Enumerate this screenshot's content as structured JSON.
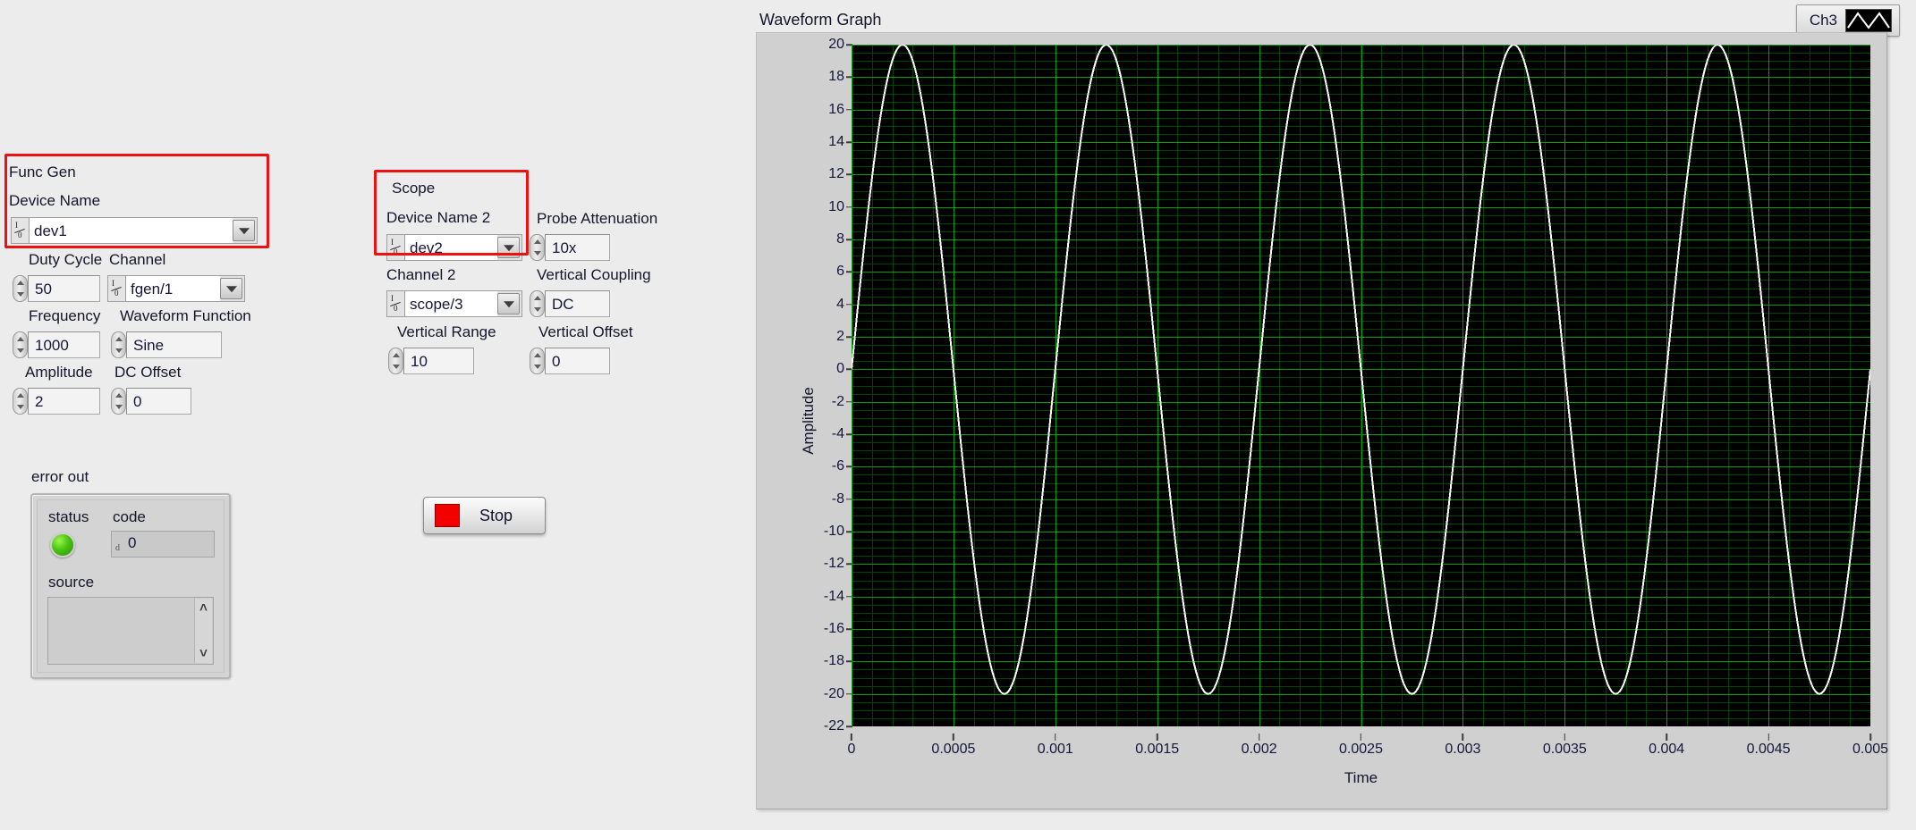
{
  "func_gen": {
    "group_label": "Func Gen",
    "device_name_label": "Device Name",
    "device_name_value": "dev1",
    "duty_cycle_label": "Duty Cycle",
    "duty_cycle_value": "50",
    "channel_label": "Channel",
    "channel_value": "fgen/1",
    "frequency_label": "Frequency",
    "frequency_value": "1000",
    "waveform_function_label": "Waveform Function",
    "waveform_function_value": "Sine",
    "amplitude_label": "Amplitude",
    "amplitude_value": "2",
    "dc_offset_label": "DC Offset",
    "dc_offset_value": "0"
  },
  "scope": {
    "group_label": "Scope",
    "device_name_label": "Device Name 2",
    "device_name_value": "dev2",
    "channel_label": "Channel 2",
    "channel_value": "scope/3",
    "vertical_range_label": "Vertical Range",
    "vertical_range_value": "10",
    "probe_attenuation_label": "Probe Attenuation",
    "probe_attenuation_value": "10x",
    "vertical_coupling_label": "Vertical Coupling",
    "vertical_coupling_value": "DC",
    "vertical_offset_label": "Vertical Offset",
    "vertical_offset_value": "0"
  },
  "error_out": {
    "group_label": "error out",
    "status_label": "status",
    "status_value": "",
    "code_label": "code",
    "code_prefix": "d",
    "code_value": "0",
    "source_label": "source",
    "source_value": "",
    "scroll_up": "˄",
    "scroll_down": "˅"
  },
  "stop_button": {
    "label": "Stop",
    "swatch_color": "#f40000"
  },
  "graph": {
    "title": "Waveform Graph",
    "legend_name": "Ch3"
  },
  "chart_data": {
    "type": "line",
    "title": "Waveform Graph",
    "xlabel": "Time",
    "ylabel": "Amplitude",
    "xlim": [
      0,
      0.005
    ],
    "ylim": [
      -22,
      20
    ],
    "xticks": [
      "0",
      "0.0005",
      "0.001",
      "0.0015",
      "0.002",
      "0.0025",
      "0.003",
      "0.0035",
      "0.004",
      "0.0045",
      "0.005"
    ],
    "xtick_values": [
      0,
      0.0005,
      0.001,
      0.0015,
      0.002,
      0.0025,
      0.003,
      0.0035,
      0.004,
      0.0045,
      0.005
    ],
    "yticks": [
      "20",
      "18",
      "16",
      "14",
      "12",
      "10",
      "8",
      "6",
      "4",
      "2",
      "0",
      "-2",
      "-4",
      "-6",
      "-8",
      "-10",
      "-12",
      "-14",
      "-16",
      "-18",
      "-20",
      "-22"
    ],
    "ytick_values": [
      20,
      18,
      16,
      14,
      12,
      10,
      8,
      6,
      4,
      2,
      0,
      -2,
      -4,
      -6,
      -8,
      -10,
      -12,
      -14,
      -16,
      -18,
      -20,
      -22
    ],
    "grid": true,
    "grid_major_color": "#00a000",
    "grid_minor_color": "#004400",
    "plot_background": "#000000",
    "legend_position": "top-right",
    "series": [
      {
        "name": "Ch3",
        "color": "#ffffff",
        "waveform": "sine",
        "amplitude": 20,
        "frequency_hz": 1000,
        "phase_deg": 0,
        "dc_offset": 0,
        "cycles_shown": 5,
        "peak_value": 20,
        "trough_value": -20,
        "sample_count": 500
      }
    ]
  }
}
